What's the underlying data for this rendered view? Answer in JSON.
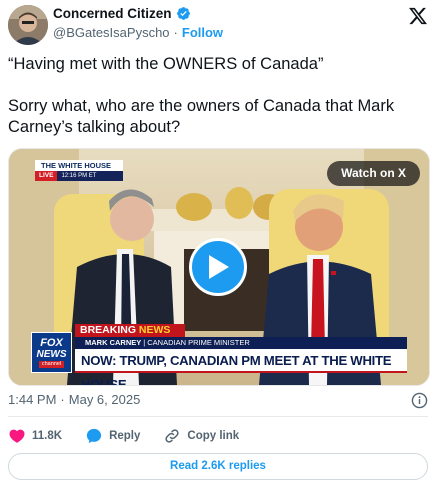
{
  "header": {
    "display_name": "Concerned Citizen",
    "handle": "@BGatesIsaPyscho",
    "separator": "·",
    "follow_label": "Follow"
  },
  "tweet": {
    "line1": "“Having met with the OWNERS of Canada”",
    "line2": "Sorry what, who are the owners of Canada that Mark Carney’s talking about?"
  },
  "media": {
    "watch_label": "Watch on X",
    "bug_title": "THE WHITE HOUSE",
    "bug_live": "LIVE",
    "bug_time": "12:16 PM ET",
    "fox_line1": "FOX",
    "fox_line2": "NEWS",
    "fox_line3": "channel",
    "breaking_a": "BREAKING ",
    "breaking_b": "NEWS",
    "name_main": "MARK CARNEY",
    "name_sub": "| CANADIAN PRIME MINISTER",
    "headline": "NOW: TRUMP, CANADIAN PM MEET AT THE WHITE HOUSE"
  },
  "meta": {
    "time": "1:44 PM",
    "separator": "·",
    "date": "May 6, 2025"
  },
  "actions": {
    "likes": "11.8K",
    "reply_label": "Reply",
    "copy_link_label": "Copy link"
  },
  "replies_button": "Read 2.6K replies",
  "colors": {
    "accent": "#1d9bf0",
    "like": "#f91880",
    "verified": "#1d9bf0"
  },
  "icons": [
    "verified-badge-icon",
    "x-logo-icon",
    "play-icon",
    "info-icon",
    "heart-icon",
    "reply-icon",
    "link-icon"
  ]
}
